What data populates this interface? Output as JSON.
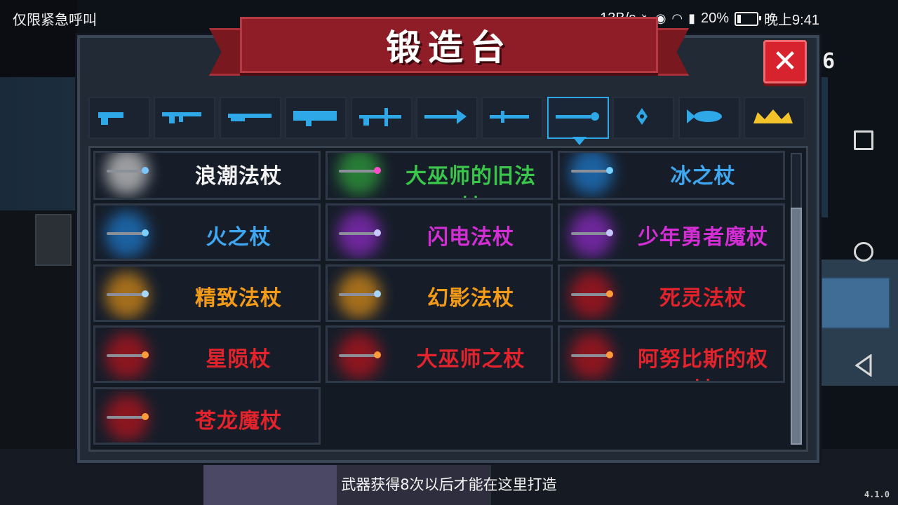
{
  "status_bar": {
    "left_text": "仅限紧急呼叫",
    "network_speed": "13B/s",
    "battery_percent": "20%",
    "time": "晚上9:41",
    "battery_level": 0.2,
    "icons": [
      "mute-icon",
      "eye-icon",
      "wifi-icon",
      "signal-icon",
      "battery-icon"
    ]
  },
  "panel": {
    "title": "锻造台",
    "close_label": "✕",
    "side_count": "6"
  },
  "tabs": [
    {
      "icon": "pistol-icon",
      "active": false
    },
    {
      "icon": "assault-rifle-icon",
      "active": false
    },
    {
      "icon": "shotgun-icon",
      "active": false
    },
    {
      "icon": "rocket-launcher-icon",
      "active": false
    },
    {
      "icon": "crossbow-icon",
      "active": false
    },
    {
      "icon": "bow-icon",
      "active": false
    },
    {
      "icon": "sword-icon",
      "active": false
    },
    {
      "icon": "staff-icon",
      "active": true
    },
    {
      "icon": "shuriken-icon",
      "active": false
    },
    {
      "icon": "fish-icon",
      "active": false
    },
    {
      "icon": "crown-icon",
      "active": false
    }
  ],
  "items": [
    {
      "name": "浪潮法杖",
      "color": "white"
    },
    {
      "name": "大巫师的旧法杖",
      "color": "green"
    },
    {
      "name": "冰之杖",
      "color": "blue"
    },
    {
      "name": "火之杖",
      "color": "blue"
    },
    {
      "name": "闪电法杖",
      "color": "purple"
    },
    {
      "name": "少年勇者魔杖",
      "color": "purple"
    },
    {
      "name": "精致法杖",
      "color": "orange"
    },
    {
      "name": "幻影法杖",
      "color": "orange"
    },
    {
      "name": "死灵法杖",
      "color": "red"
    },
    {
      "name": "星陨杖",
      "color": "red"
    },
    {
      "name": "大巫师之杖",
      "color": "red"
    },
    {
      "name": "阿努比斯的权杖",
      "color": "red"
    },
    {
      "name": "苍龙魔杖",
      "color": "red"
    }
  ],
  "hint": "武器获得8次以后才能在这里打造",
  "version": "4.1.0",
  "colors": {
    "tab_icon": "#2ea8e6",
    "crown": "#f2c42a",
    "ribbon": "#8e1d27",
    "close": "#d6232d"
  }
}
